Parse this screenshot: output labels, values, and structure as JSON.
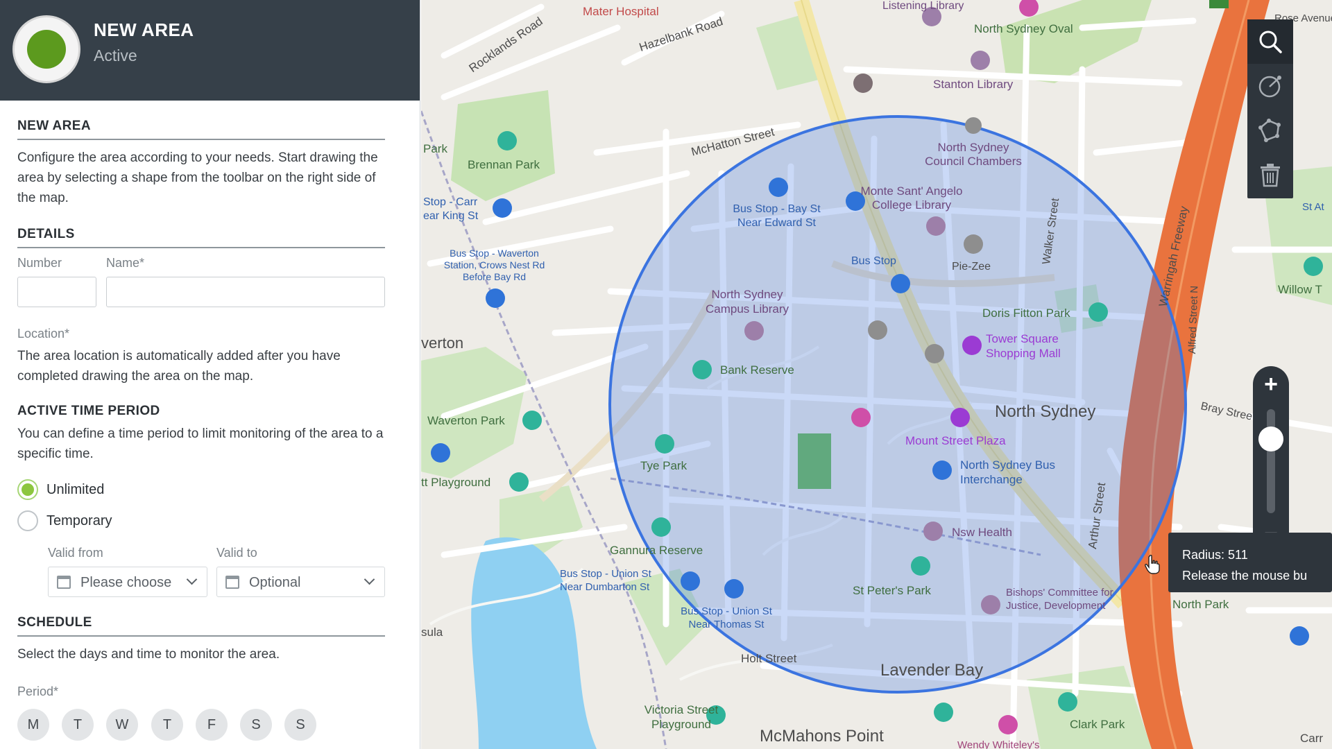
{
  "header": {
    "title": "NEW AREA",
    "status": "Active"
  },
  "intro": {
    "title": "NEW AREA",
    "text": "Configure the area according to your needs. Start drawing the area by selecting a shape from the toolbar on the right side of the map."
  },
  "details": {
    "title": "DETAILS",
    "number_label": "Number",
    "number_value": "",
    "name_label": "Name*",
    "name_value": "",
    "location_label": "Location*",
    "location_text": "The area location is automatically added after you have completed drawing the area on the map."
  },
  "active_time_period": {
    "title": "ACTIVE TIME PERIOD",
    "text": "You can define a time period to limit monitoring of the area to a specific time.",
    "options": [
      {
        "label": "Unlimited",
        "selected": true
      },
      {
        "label": "Temporary",
        "selected": false
      }
    ],
    "valid_from_label": "Valid from",
    "valid_from_value": "Please choose",
    "valid_to_label": "Valid to",
    "valid_to_value": "Optional"
  },
  "schedule": {
    "title": "SCHEDULE",
    "text": "Select the days and time to monitor the area.",
    "period_label": "Period*",
    "days": [
      "M",
      "T",
      "W",
      "T",
      "F",
      "S",
      "S"
    ]
  },
  "map": {
    "tooltip_radius": "Radius: 511",
    "tooltip_hint": "Release the mouse bu",
    "zoom_level_fraction": 0.78,
    "circle_color": "#3b74e0",
    "labels": {
      "mater_hospital": "Mater Hospital",
      "hazelbank_road": "Hazelbank Road",
      "rocklands_road": "Rocklands Road",
      "listening_library": "Listening Library",
      "north_sydney_oval": "North Sydney Oval",
      "rose_avenue": "Rose Avenue",
      "stanton_library": "Stanton Library",
      "mchatton_street": "McHatton Street",
      "north_sydney_council": "North Sydney Council Chambers",
      "monte_sant_angelo": "Monte Sant' Angelo College Library",
      "brennan_park": "Brennan Park",
      "park": "Park",
      "stop_carr": "Stop - Carr ear King St",
      "bus_stop_bay_st": "Bus Stop - Bay St Near Edward St",
      "waverton_station": "Bus Stop - Waverton Station, Crows Nest Rd Before Bay Rd",
      "bus_stop": "Bus Stop",
      "pie_zee": "Pie-Zee",
      "walker_street": "Walker Street",
      "warringah_freeway": "Warringah Freeway",
      "willow_t": "Willow T",
      "st_at": "St At",
      "north_sydney_campus_library": "North Sydney Campus Library",
      "doris_fitton_park": "Doris Fitton Park",
      "tower_square": "Tower Square Shopping Mall",
      "werton": "verton",
      "bank_reserve": "Bank Reserve",
      "north_sydney": "North Sydney",
      "mount_street_plaza": "Mount Street Plaza",
      "bray_street": "Bray Stree",
      "waverton_park": "Waverton Park",
      "tye_park": "Tye Park",
      "north_sydney_bus_interchange": "North Sydney Bus Interchange",
      "arthur_street": "Arthur Street",
      "alfred_street_n": "Alfred Street N",
      "tt_playground": "tt Playground",
      "gannura_reserve": "Gannura Reserve",
      "nsw_health": "Nsw Health",
      "bus_stop_union_dumbarton": "Bus Stop - Union St Near Dumbarton St",
      "st_peters_park": "St Peter's Park",
      "bishops_committee": "Bishops' Committee for Justice, Development",
      "north_park": "North Park",
      "bus_stop_union_thomas": "Bus Stop - Union St Near Thomas St",
      "sula": "sula",
      "holt_street": "Holt Street",
      "lavender_bay": "Lavender Bay",
      "victoria_street_playground": "Victoria Street Playground",
      "mcmahons_point": "McMahons Point",
      "clark_park": "Clark Park",
      "wendy_whiteleys": "Wendy Whiteley's",
      "carr": "Carr"
    }
  }
}
